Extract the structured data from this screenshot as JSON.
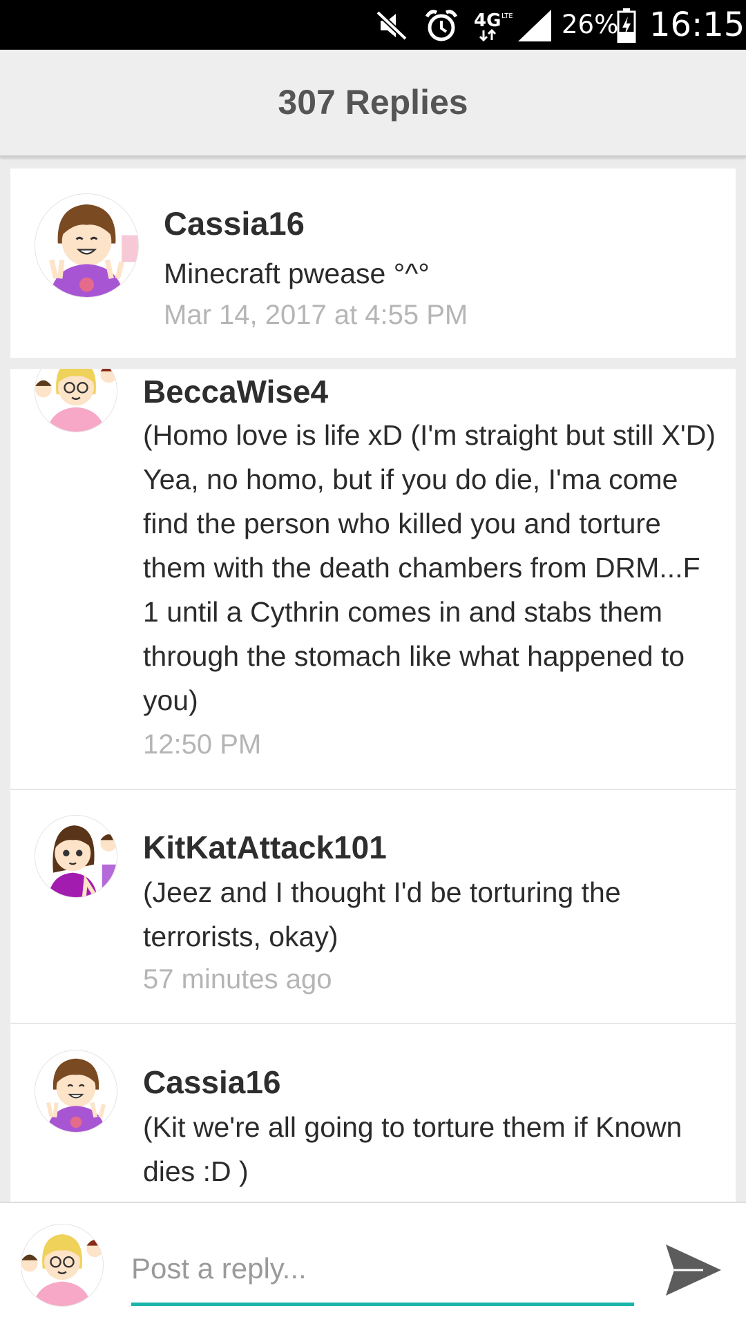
{
  "status_bar": {
    "network": "4G",
    "battery": "26%",
    "time": "16:15",
    "icons": [
      "mute-icon",
      "alarm-icon",
      "network-4g-icon",
      "signal-icon",
      "battery-icon"
    ]
  },
  "header": {
    "title": "307 Replies"
  },
  "comments": [
    {
      "username": "Cassia16",
      "text": "Minecraft pwease °^°",
      "time": "Mar 14, 2017 at 4:55 PM"
    },
    {
      "username": "BeccaWise4",
      "text": "(Homo love is life xD (I'm straight but still X'D) Yea, no homo, but if you do die, I'ma come find the person who killed you and torture them with the death chambers from DRM...F 1 until a Cythrin comes in and stabs them through the stomach like what happened to you)",
      "time": "12:50 PM"
    },
    {
      "username": "KitKatAttack101",
      "text": "(Jeez and I thought I'd be torturing the terrorists, okay)",
      "time": "57 minutes ago"
    },
    {
      "username": "Cassia16",
      "text": "(Kit we're all going to torture them if Known dies :D )",
      "time": ""
    }
  ],
  "reply_bar": {
    "placeholder": "Post a reply..."
  },
  "colors": {
    "accent": "#1ab5a9",
    "header_bg": "#eeeeee",
    "timestamp": "#b5b5b5"
  }
}
